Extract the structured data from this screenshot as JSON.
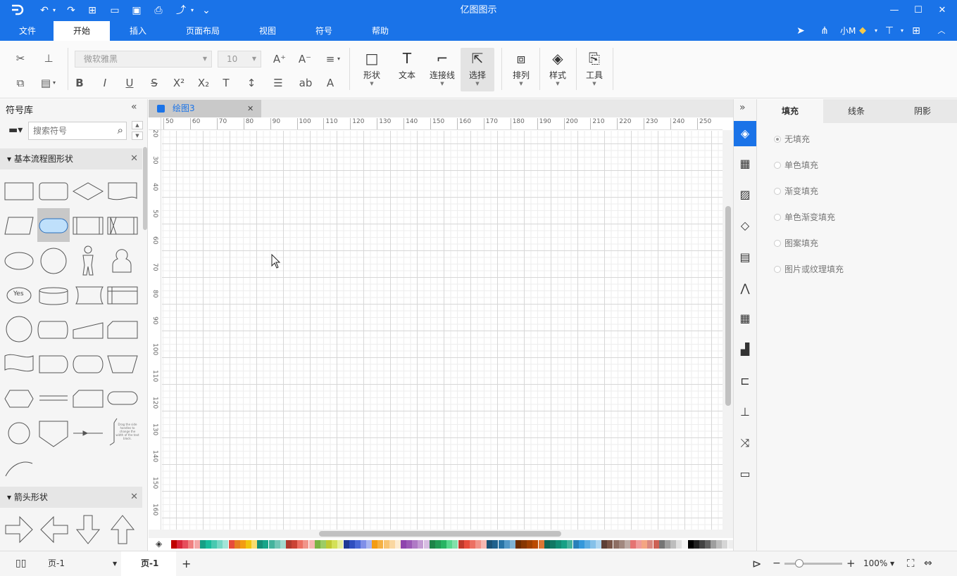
{
  "app": {
    "title": "亿图图示"
  },
  "quick_access": {
    "logo_icon": "app-logo-icon",
    "undo": "↶",
    "redo": "↷",
    "new": "⊞",
    "open": "▭",
    "save": "▣",
    "print": "⎙",
    "export": "⤴",
    "more": "⌄"
  },
  "window": {
    "minimize": "—",
    "maximize": "☐",
    "close": "✕"
  },
  "menu": {
    "tabs": [
      "文件",
      "开始",
      "插入",
      "页面布局",
      "视图",
      "符号",
      "帮助"
    ],
    "active": "开始",
    "right_user": "小M"
  },
  "ribbon": {
    "font_family": "微软雅黑",
    "font_size": "10",
    "big_buttons": [
      "形状",
      "文本",
      "连接线",
      "选择",
      "排列",
      "样式",
      "工具"
    ],
    "active_button": "选择"
  },
  "symbol_library": {
    "title": "符号库",
    "search_placeholder": "搜索符号",
    "categories": [
      "基本流程图形状",
      "箭头形状"
    ],
    "yes_label": "Yes",
    "note_text": "Drag the side handles to change the width of the text block."
  },
  "document": {
    "tab_title": "绘图3",
    "ruler_top": [
      "50",
      "60",
      "70",
      "80",
      "90",
      "100",
      "110",
      "120",
      "130",
      "140",
      "150",
      "160",
      "170",
      "180",
      "190",
      "200",
      "210",
      "220",
      "230",
      "240",
      "250"
    ],
    "ruler_left": [
      "20",
      "30",
      "40",
      "50",
      "60",
      "70",
      "80",
      "90",
      "100",
      "110",
      "120",
      "130",
      "140",
      "150",
      "160"
    ]
  },
  "palette": {
    "colors": [
      "#c00000",
      "#d9263a",
      "#e64d5c",
      "#f08080",
      "#f4a6a6",
      "#16a085",
      "#1abc9c",
      "#48c9b0",
      "#76d7c4",
      "#a3e4d7",
      "#e74c3c",
      "#e67e22",
      "#f39c12",
      "#f1c40f",
      "#f7dc6f",
      "#148f77",
      "#17a589",
      "#45b39d",
      "#73c6b6",
      "#a2d9ce",
      "#b03a2e",
      "#cb4335",
      "#ec7063",
      "#f1948a",
      "#f5b7b1",
      "#7cb342",
      "#9ccc65",
      "#c0ca33",
      "#d4e157",
      "#e6ee9c",
      "#1f3a93",
      "#2e4fbf",
      "#4a69d6",
      "#7f8fe8",
      "#a9b5f0",
      "#f39c12",
      "#f5b041",
      "#f8c471",
      "#fad7a0",
      "#fdebd0",
      "#8e44ad",
      "#9b59b6",
      "#af7ac5",
      "#c39bd3",
      "#d7bde2",
      "#1e8449",
      "#239b56",
      "#28b463",
      "#58d68d",
      "#82e0aa",
      "#c0392b",
      "#e74c3c",
      "#ec7063",
      "#f1948a",
      "#f5b7b1",
      "#1a5276",
      "#1f618d",
      "#2874a6",
      "#5499c7",
      "#7fb3d5",
      "#6e2c00",
      "#873600",
      "#a04000",
      "#ba4a00",
      "#dc7633",
      "#0e6655",
      "#117864",
      "#138d75",
      "#16a085",
      "#45b39d",
      "#2980b9",
      "#3498db",
      "#5dade2",
      "#85c1e9",
      "#aed6f1",
      "#5d4037",
      "#795548",
      "#8d6e63",
      "#a1887f",
      "#bcaaa4",
      "#e57373",
      "#ef9a9a",
      "#f4a582",
      "#d98880",
      "#cd6155",
      "#757575",
      "#9e9e9e",
      "#bdbdbd",
      "#e0e0e0",
      "#f5f5f5",
      "#000000",
      "#212121",
      "#424242",
      "#616161",
      "#9e9e9e",
      "#bdbdbd",
      "#d6d6d6",
      "#eeeeee",
      "#ffffff"
    ]
  },
  "side_icons": [
    "fill-icon",
    "widgets-icon",
    "image-icon",
    "layers-icon",
    "page-icon",
    "chart-icon",
    "table-icon",
    "org-icon",
    "timeline-icon",
    "hierarchy-icon",
    "shuffle-icon",
    "presentation-icon"
  ],
  "right_panel": {
    "tabs": [
      "填充",
      "线条",
      "阴影"
    ],
    "active_tab": "填充",
    "fill_options": [
      "无填充",
      "单色填充",
      "渐变填充",
      "单色渐变填充",
      "图案填充",
      "图片或纹理填充"
    ],
    "selected": "无填充"
  },
  "statusbar": {
    "page_selector": "页-1",
    "page_tab": "页-1",
    "add_page": "+",
    "zoom": "100%",
    "zoom_minus": "−",
    "zoom_plus": "+"
  }
}
